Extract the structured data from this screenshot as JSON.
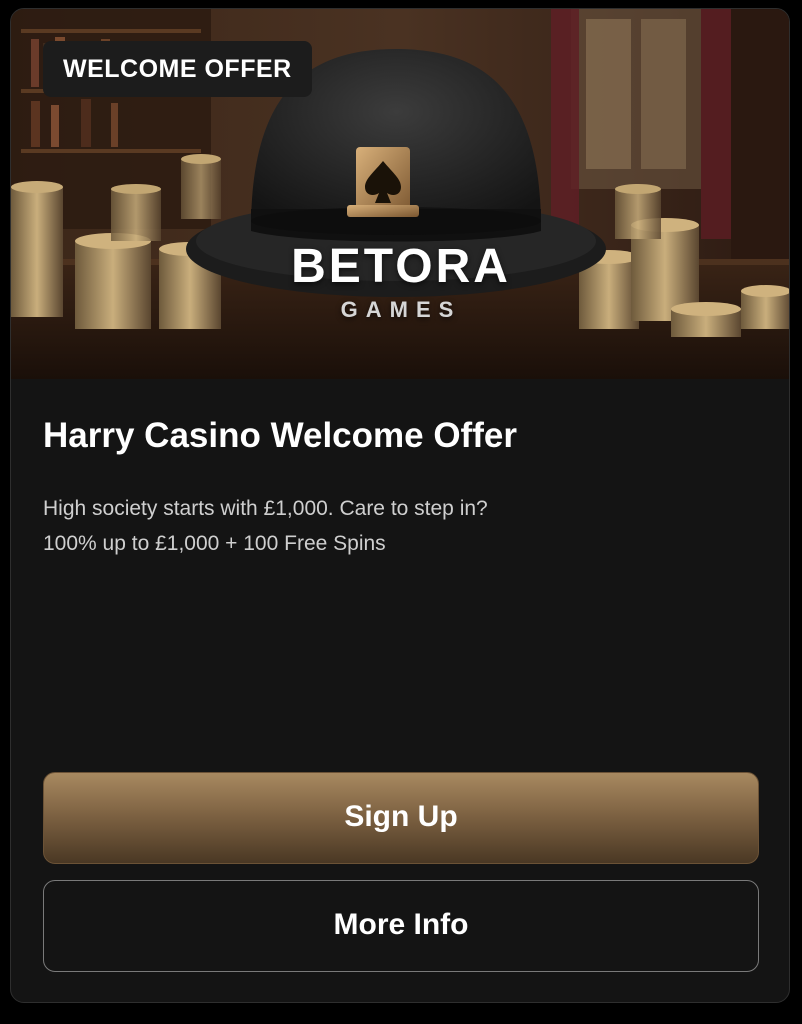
{
  "offer": {
    "badge": "WELCOME OFFER",
    "brand_name": "BETORA",
    "brand_sub": "GAMES",
    "title": "Harry Casino Welcome Offer",
    "description_lines": [
      "High society starts with £1,000. Care to step in?",
      "100% up to £1,000 + 100 Free Spins"
    ]
  },
  "actions": {
    "sign_up": "Sign Up",
    "more_info": "More Info"
  },
  "colors": {
    "card_background": "#141414",
    "primary_button_gold": "#a88960",
    "brand_accent_orange": "#f28a1e"
  },
  "icons": {
    "hero": "bowler-hat-with-spade-emblem",
    "decor": "gold-coin-stacks"
  }
}
